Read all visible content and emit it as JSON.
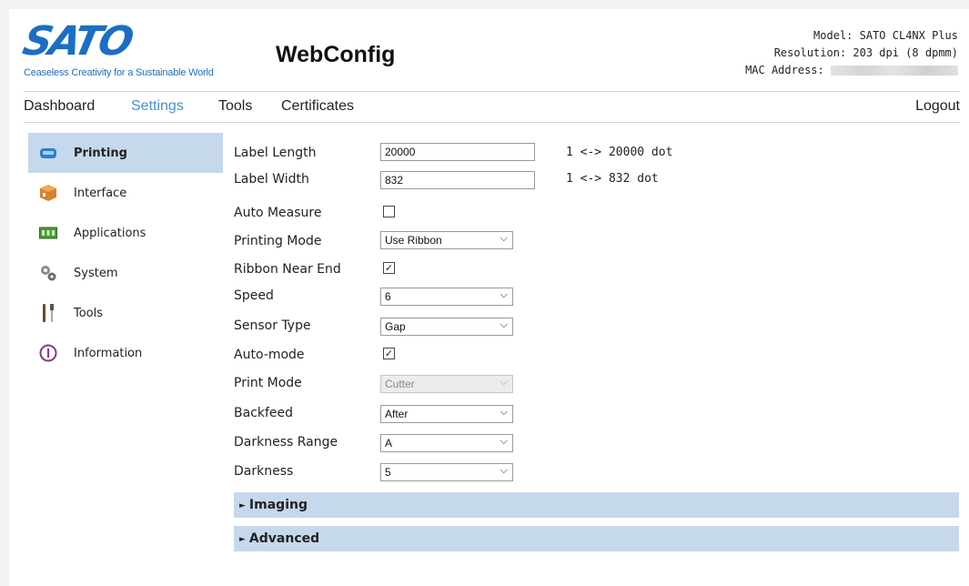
{
  "header": {
    "logo_text": "SATO",
    "logo_tagline": "Ceaseless Creativity for a Sustainable World",
    "app_title": "WebConfig",
    "model": "Model: SATO CL4NX Plus",
    "resolution": "Resolution: 203 dpi (8 dpmm)",
    "mac_label": "MAC Address:"
  },
  "nav": {
    "items": [
      "Dashboard",
      "Settings",
      "Tools",
      "Certificates"
    ],
    "active": "Settings",
    "logout": "Logout"
  },
  "sidebar": {
    "items": [
      {
        "label": "Printing",
        "icon": "printer-icon",
        "active": true
      },
      {
        "label": "Interface",
        "icon": "interface-icon",
        "active": false
      },
      {
        "label": "Applications",
        "icon": "applications-icon",
        "active": false
      },
      {
        "label": "System",
        "icon": "gears-icon",
        "active": false
      },
      {
        "label": "Tools",
        "icon": "tools-icon",
        "active": false
      },
      {
        "label": "Information",
        "icon": "info-icon",
        "active": false
      }
    ]
  },
  "form": {
    "label_length": {
      "label": "Label Length",
      "value": "20000",
      "range": "1 <-> 20000 dot"
    },
    "label_width": {
      "label": "Label Width",
      "value": "832",
      "range": "1 <-> 832 dot"
    },
    "auto_measure": {
      "label": "Auto Measure",
      "checked": false
    },
    "printing_mode": {
      "label": "Printing Mode",
      "value": "Use Ribbon"
    },
    "ribbon_near_end": {
      "label": "Ribbon Near End",
      "checked": true
    },
    "speed": {
      "label": "Speed",
      "value": "6"
    },
    "sensor_type": {
      "label": "Sensor Type",
      "value": "Gap"
    },
    "auto_mode": {
      "label": "Auto-mode",
      "checked": true
    },
    "print_mode": {
      "label": "Print Mode",
      "value": "Cutter",
      "disabled": true
    },
    "backfeed": {
      "label": "Backfeed",
      "value": "After"
    },
    "darkness_range": {
      "label": "Darkness Range",
      "value": "A"
    },
    "darkness": {
      "label": "Darkness",
      "value": "5"
    }
  },
  "sections": {
    "imaging": "Imaging",
    "advanced": "Advanced"
  },
  "colors": {
    "brand_blue": "#1a6fc4",
    "active_nav": "#4a90c8",
    "highlight": "#c5d8ec"
  }
}
